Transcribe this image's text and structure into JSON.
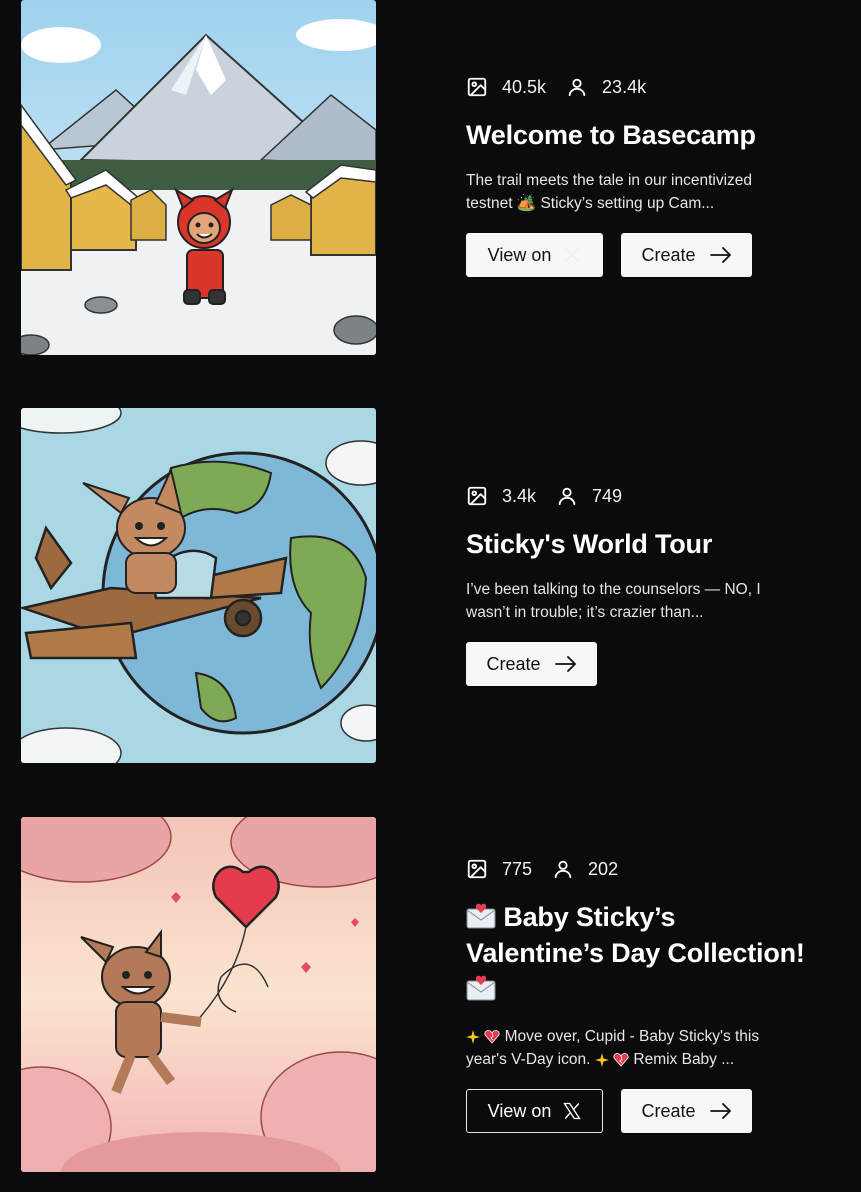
{
  "posts": [
    {
      "images": "40.5k",
      "users": "23.4k",
      "title": "Welcome to Basecamp",
      "desc_line1": "The trail meets the tale in our incentivized",
      "desc_line2": "testnet 🏕️ Sticky’s setting up Cam...",
      "view_label": "View on",
      "create_label": "Create"
    },
    {
      "images": "3.4k",
      "users": "749",
      "title": "Sticky's World Tour",
      "desc_line1": "I’ve been talking to the counselors — NO, I",
      "desc_line2": "wasn’t in trouble; it’s crazier than...",
      "create_label": "Create"
    },
    {
      "images": "775",
      "users": "202",
      "title_line1": "Baby Sticky’s",
      "title_line2": "Valentine’s Day Collection!",
      "desc_line1_a": "Move over, Cupid - Baby Sticky's this",
      "desc_line2_a": "year's V-Day icon.",
      "desc_line2_b": "Remix Baby ...",
      "view_label": "View on",
      "create_label": "Create"
    }
  ],
  "icons": {
    "images": "image-icon",
    "users": "user-icon",
    "arrow": "arrow-right-icon",
    "x": "x-logo-icon",
    "letter": "love-letter-emoji",
    "sparkle": "sparkle-emoji",
    "heart": "broken-heart-emoji"
  },
  "colors": {
    "background": "#0b0b0d",
    "button_light": "#f7f7f7",
    "text": "#ffffff"
  }
}
